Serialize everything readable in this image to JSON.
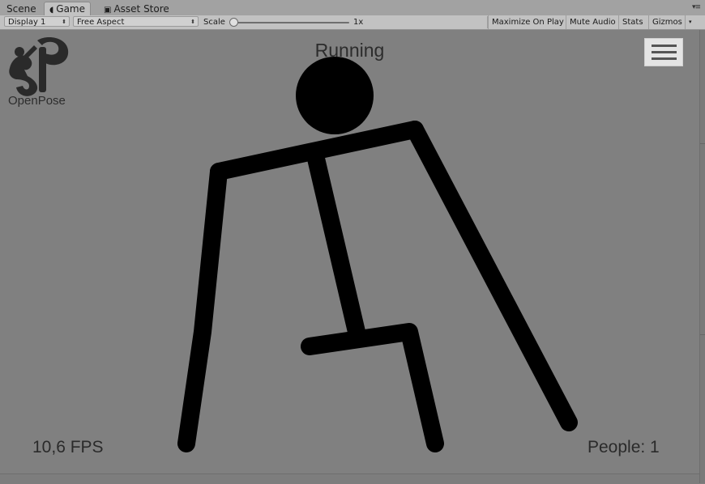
{
  "tabs": [
    {
      "label": "Scene",
      "active": false,
      "icon": ""
    },
    {
      "label": "Game",
      "active": true,
      "icon": "pacman-icon"
    },
    {
      "label": "Asset Store",
      "active": false,
      "icon": "store-icon"
    }
  ],
  "toolbar": {
    "display": "Display 1",
    "aspect": "Free Aspect",
    "scale_label": "Scale",
    "scale_value": "1x",
    "maximize": "Maximize On Play",
    "mute": "Mute Audio",
    "stats": "Stats",
    "gizmos": "Gizmos"
  },
  "game": {
    "status": "Running",
    "logo_text": "OpenPose",
    "fps": "10,6 FPS",
    "people": "People: 1"
  },
  "colors": {
    "viewport_bg": "#808080",
    "figure": "#000000"
  }
}
